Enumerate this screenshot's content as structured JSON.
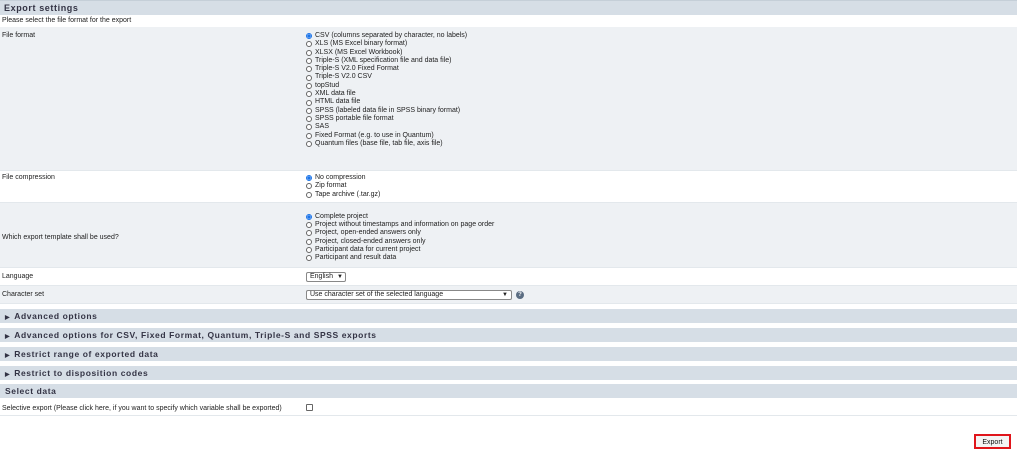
{
  "export_settings": {
    "title": "Export settings",
    "instruction": "Please select the file format for the export"
  },
  "file_format": {
    "label": "File format",
    "options": [
      {
        "label": "CSV (columns separated by character, no labels)",
        "selected": true
      },
      {
        "label": "XLS (MS Excel binary format)",
        "selected": false
      },
      {
        "label": "XLSX (MS Excel Workbook)",
        "selected": false
      },
      {
        "label": "Triple-S (XML specification file and data file)",
        "selected": false
      },
      {
        "label": "Triple-S V2.0 Fixed Format",
        "selected": false
      },
      {
        "label": "Triple-S V2.0 CSV",
        "selected": false
      },
      {
        "label": "topStud",
        "selected": false
      },
      {
        "label": "XML data file",
        "selected": false
      },
      {
        "label": "HTML data file",
        "selected": false
      },
      {
        "label": "SPSS (labeled data file in SPSS binary format)",
        "selected": false
      },
      {
        "label": "SPSS portable file format",
        "selected": false
      },
      {
        "label": "SAS",
        "selected": false
      },
      {
        "label": "Fixed Format (e.g. to use in Quantum)",
        "selected": false
      },
      {
        "label": "Quantum files (base file, tab file, axis file)",
        "selected": false
      }
    ]
  },
  "file_compression": {
    "label": "File compression",
    "options": [
      {
        "label": "No compression",
        "selected": true
      },
      {
        "label": "Zip format",
        "selected": false
      },
      {
        "label": "Tape archive (.tar.gz)",
        "selected": false
      }
    ]
  },
  "template": {
    "label": "Which export template shall be used?",
    "options": [
      {
        "label": "Complete project",
        "selected": true
      },
      {
        "label": "Project without timestamps and information on page order",
        "selected": false
      },
      {
        "label": "Project, open-ended answers only",
        "selected": false
      },
      {
        "label": "Project, closed-ended answers only",
        "selected": false
      },
      {
        "label": "Participant data for current project",
        "selected": false
      },
      {
        "label": "Participant and result data",
        "selected": false
      }
    ]
  },
  "language": {
    "label": "Language",
    "value": "English"
  },
  "charset": {
    "label": "Character set",
    "value": "Use character set of the selected language",
    "help_icon": "help-icon"
  },
  "sections": {
    "advanced": "Advanced options",
    "advanced_csv": "Advanced options for CSV, Fixed Format, Quantum, Triple-S and SPSS exports",
    "restrict_range": "Restrict range of exported data",
    "restrict_disposition": "Restrict to disposition codes"
  },
  "select_data": {
    "title": "Select data",
    "selective_label": "Selective export (Please click here, if you want to specify which variable shall be exported)",
    "checked": false
  },
  "export_button": "Export",
  "colors": {
    "header_bg": "#d6dee6",
    "radio_accent": "#1a73e8",
    "export_highlight": "#e0151b"
  }
}
